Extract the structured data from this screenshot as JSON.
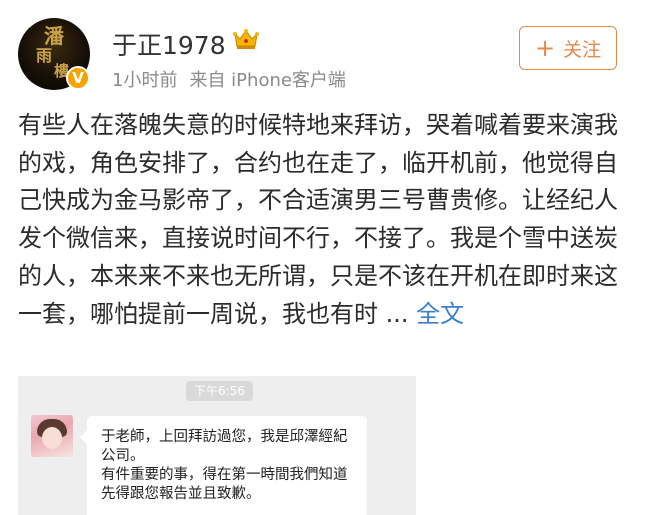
{
  "user": {
    "name": "于正1978",
    "avatar_text": "潘雨樓",
    "verified_badge": "V"
  },
  "meta": {
    "time": "1小时前",
    "source": "来自 iPhone客户端"
  },
  "follow_button": {
    "icon": "+",
    "label": "关注"
  },
  "post": {
    "text": "有些人在落魄失意的时候特地来拜访，哭着喊着要来演我的戏，角色安排了，合约也在走了，临开机前，他觉得自己快成为金马影帝了，不合适演男三号曹贵修。让经纪人发个微信来，直接说时间不行，不接了。我是个雪中送炭的人，本来来不来也无所谓，只是不该在开机在即时来这一套，哪怕提前一周说，我也有时 ... ",
    "more_link": "全文"
  },
  "chat": {
    "time": "下午6:56",
    "messages": [
      "于老師，上回拜訪過您，我是邱澤經紀公司。",
      "有件重要的事，得在第一時間我們知道先得跟您報告並且致歉。"
    ]
  },
  "colors": {
    "accent_orange": "#e8894c",
    "link_blue": "#3d7fcf",
    "badge_gold": "#f5a300"
  },
  "icons": [
    "vip-crown-icon",
    "verified-v-icon",
    "plus-icon"
  ]
}
